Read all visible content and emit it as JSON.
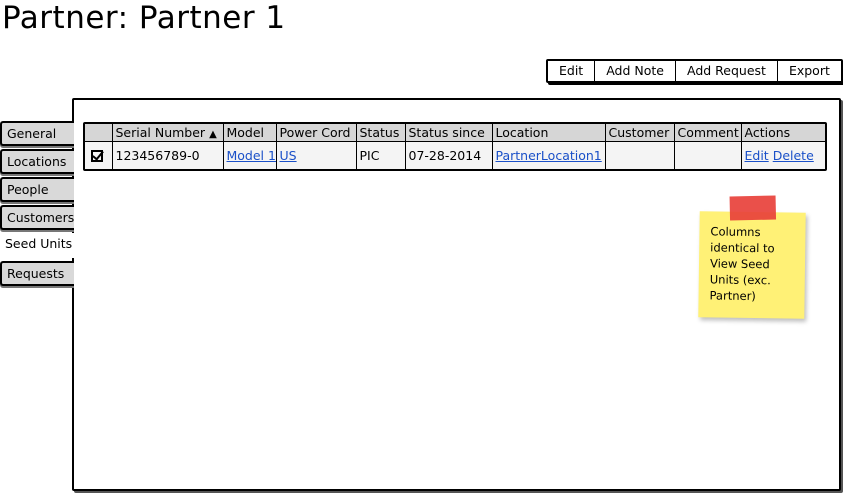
{
  "page": {
    "title": "Partner: Partner 1"
  },
  "toolbar": {
    "buttons": [
      "Edit",
      "Add Note",
      "Add Request",
      "Export"
    ]
  },
  "tabs": [
    "General",
    "Locations",
    "People",
    "Customers",
    "Seed Units",
    "Requests"
  ],
  "active_tab": "Seed Units",
  "table": {
    "headers": [
      "",
      "Serial Number",
      "Model",
      "Power Cord",
      "Status",
      "Status since",
      "Location",
      "Customer",
      "Comment",
      "Actions"
    ],
    "sorted_column": "Serial Number",
    "sort_indicator": "▲",
    "rows": [
      {
        "checked": true,
        "serial_number": "123456789-0",
        "model": "Model 1",
        "power_cord": "US",
        "status": "PIC",
        "status_since": "07-28-2014",
        "location": "PartnerLocation1",
        "customer": "",
        "comment": "",
        "actions": {
          "edit": "Edit",
          "delete": "Delete"
        }
      }
    ]
  },
  "sticky_note": {
    "text": "Columns\nidentical to\nView Seed\nUnits (exc.\nPartner)",
    "color": "#fff176",
    "tape_color": "#e8413b"
  },
  "colors": {
    "link": "#1a50c8",
    "header_bg": "#d6d6d6",
    "tab_bg": "#d9d9d9"
  }
}
